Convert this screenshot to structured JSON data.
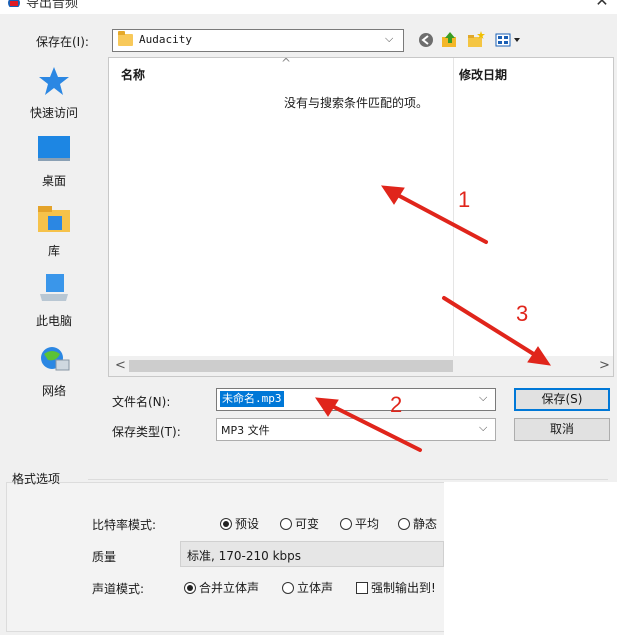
{
  "window": {
    "title": "导出音频",
    "close_glyph": "✕"
  },
  "toolbar": {
    "save_in_label": "保存在(I):",
    "save_in_value": "Audacity",
    "dropdown_glyph": "⌵",
    "icons": [
      "back-icon",
      "up-folder-icon",
      "new-folder-icon",
      "view-menu-icon"
    ]
  },
  "places": [
    {
      "label": "快速访问",
      "icon": "star-icon"
    },
    {
      "label": "桌面",
      "icon": "desktop-icon"
    },
    {
      "label": "库",
      "icon": "library-icon"
    },
    {
      "label": "此电脑",
      "icon": "computer-icon"
    },
    {
      "label": "网络",
      "icon": "network-icon"
    }
  ],
  "file_list": {
    "columns": [
      "名称",
      "修改日期"
    ],
    "sort_glyph": "^",
    "empty_message": "没有与搜索条件匹配的项。",
    "scroll_left": "<",
    "scroll_right": ">"
  },
  "form": {
    "filename_label": "文件名(N):",
    "filename_value": "未命名.mp3",
    "filetype_label": "保存类型(T):",
    "filetype_value": "MP3 文件"
  },
  "buttons": {
    "save": "保存(S)",
    "cancel": "取消"
  },
  "format_options": {
    "title": "格式选项",
    "bitrate_label": "比特率模式:",
    "bitrate_options": [
      "预设",
      "可变",
      "平均",
      "静态"
    ],
    "bitrate_selected": "预设",
    "quality_label": "质量",
    "quality_value": "标准, 170-210 kbps",
    "channel_label": "声道模式:",
    "channel_options": [
      "合并立体声",
      "立体声"
    ],
    "channel_selected": "合并立体声",
    "force_mono_label": "强制输出到!"
  },
  "annotations": {
    "color": "#e0251b",
    "labels": [
      "1",
      "2",
      "3"
    ]
  },
  "colors": {
    "accent": "#0078d7",
    "annotation": "#e0251b"
  }
}
